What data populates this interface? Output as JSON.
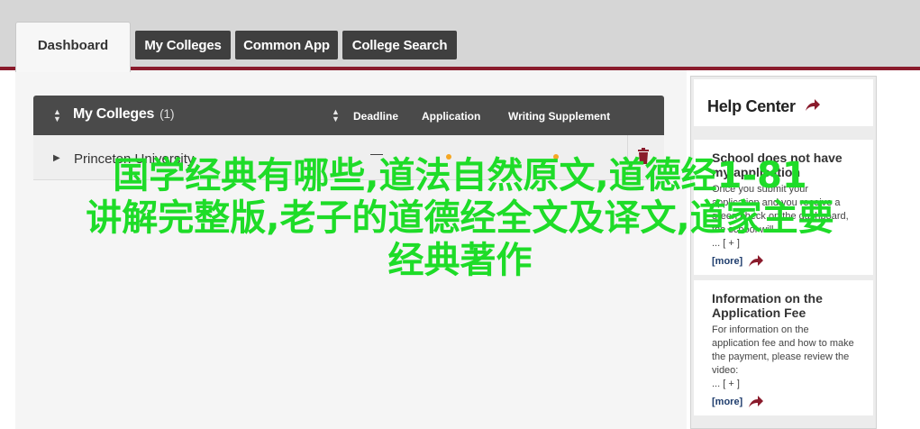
{
  "tabs": {
    "dashboard": "Dashboard",
    "my_colleges": "My Colleges",
    "common_app": "Common App",
    "college_search": "College Search"
  },
  "table": {
    "title": "My Colleges",
    "count": "(1)",
    "columns": {
      "deadline": "Deadline",
      "application": "Application",
      "writing": "Writing Supplement"
    },
    "rows": [
      {
        "name": "Princeton University",
        "deadline": "—"
      }
    ]
  },
  "help": {
    "title": "Help Center",
    "cards": [
      {
        "title": "School does not have my application",
        "body": "Once you submit your application and you receive a green check on the dashboard, the school will ...",
        "expand": "... [ + ]",
        "more": "[more]"
      },
      {
        "title": "Information on the Application Fee",
        "body": "For information on the application fee and how to make the payment, please review the video:",
        "expand": "... [ + ]",
        "more": "[more]"
      }
    ]
  },
  "overlay": {
    "line1": "国学经典有哪些,道法自然原文,道德经1-81",
    "line2": "讲解完整版,老子的道德经全文及译文,道家主要",
    "line3": "经典著作"
  },
  "colors": {
    "accent": "#8a1b2c",
    "tab_bg": "#3f3f3f",
    "overlay_text": "#1edc28",
    "status_dot": "#f5a623"
  },
  "icons": [
    "sort-icon",
    "expand-arrow-icon",
    "trash-icon",
    "arrow-right-icon"
  ]
}
